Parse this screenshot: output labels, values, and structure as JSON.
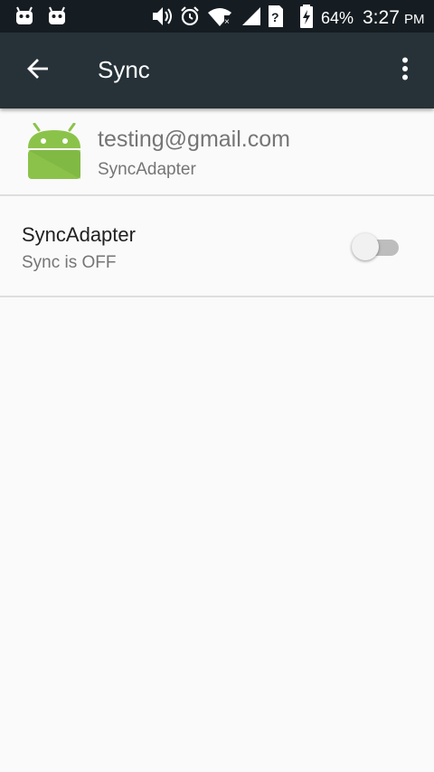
{
  "status_bar": {
    "notification_icons": [
      "android-notification-icon",
      "android-notification-icon"
    ],
    "system_icons": [
      "volume-vibrate-icon",
      "alarm-icon",
      "wifi-icon",
      "cell-signal-icon",
      "sim-unknown-icon",
      "battery-charging-icon"
    ],
    "battery_percent": "64%",
    "time": "3:27",
    "ampm": "PM"
  },
  "toolbar": {
    "title": "Sync",
    "back_icon": "arrow-back-icon",
    "overflow_icon": "more-vert-icon"
  },
  "account": {
    "email": "testing@gmail.com",
    "adapter_label": "SyncAdapter",
    "icon": "android-app-icon"
  },
  "sync_items": [
    {
      "title": "SyncAdapter",
      "summary": "Sync is OFF",
      "enabled": false
    }
  ],
  "colors": {
    "status_bar": "#161d22",
    "toolbar": "#263238",
    "background": "#fafafa",
    "android_green": "#8bc34a"
  }
}
